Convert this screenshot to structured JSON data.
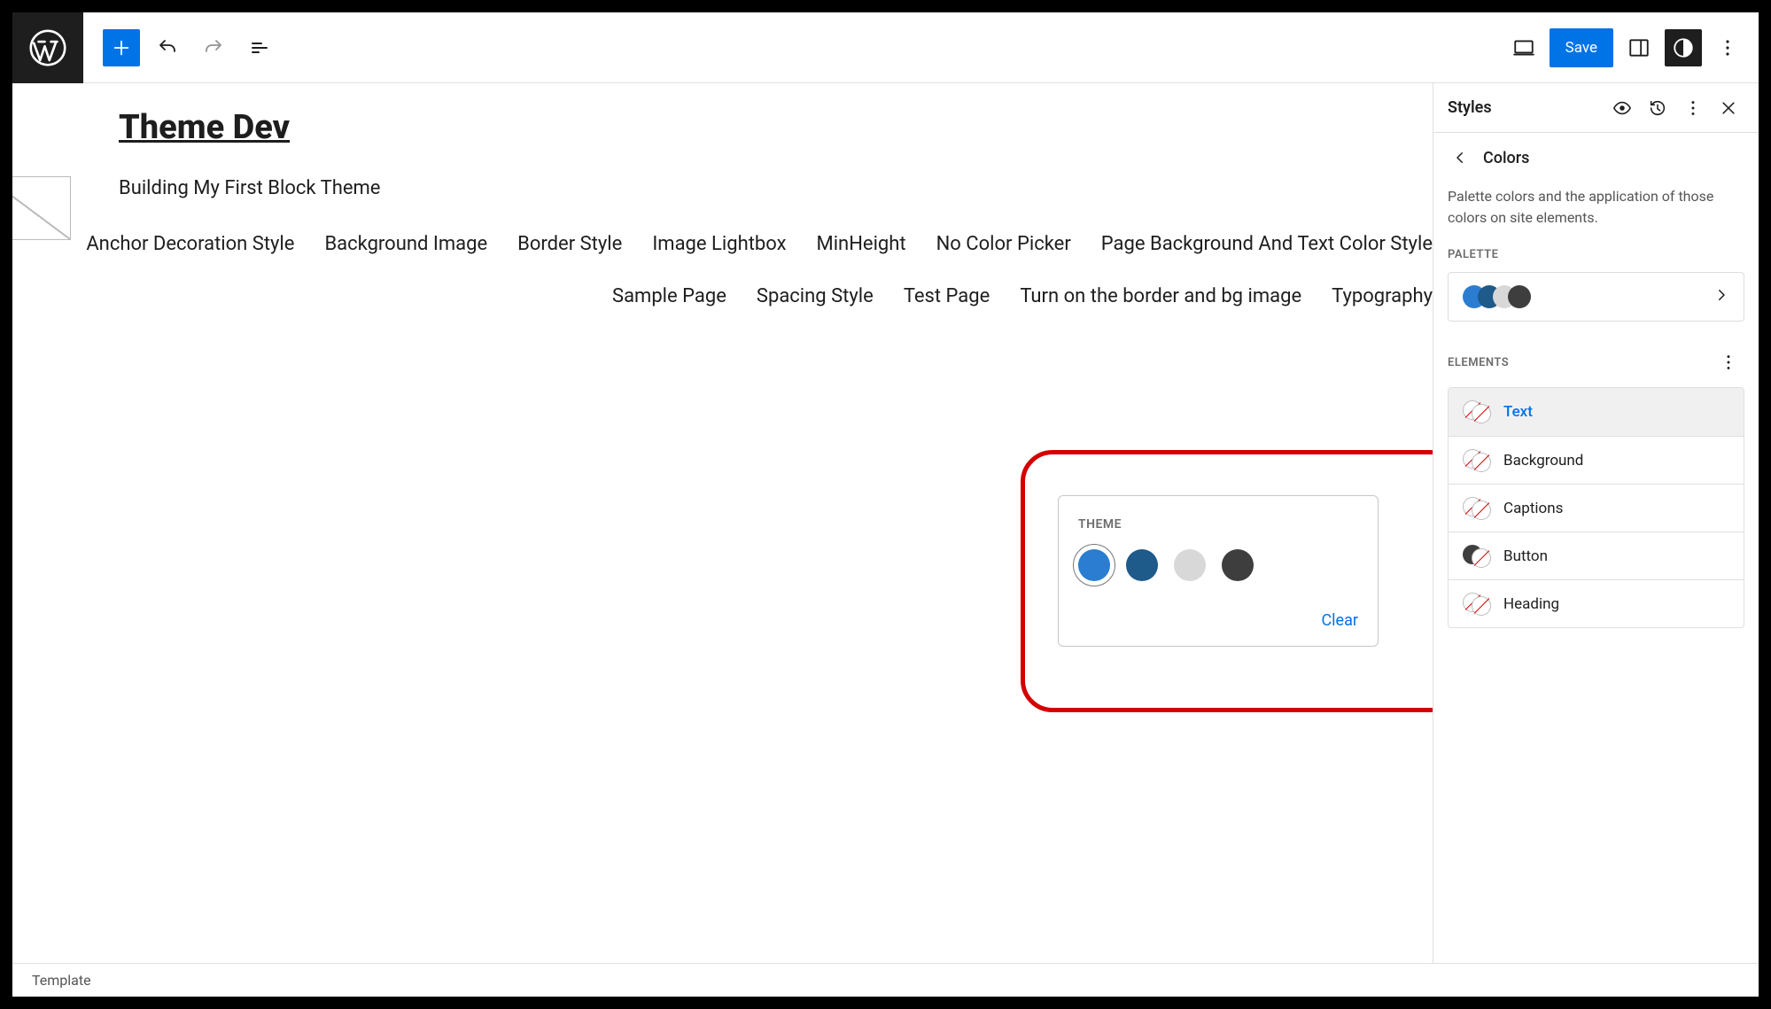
{
  "toolbar": {
    "save_label": "Save"
  },
  "site": {
    "title": "Theme Dev",
    "tagline": "Building My First Block Theme"
  },
  "nav": [
    "Anchor Decoration Style",
    "Background Image",
    "Border Style",
    "Image Lightbox",
    "MinHeight",
    "No Color Picker",
    "Page Background And Text Color Style",
    "Sample Page",
    "Spacing Style",
    "Test Page",
    "Turn on the border and bg image",
    "Typography"
  ],
  "popover": {
    "title": "THEME",
    "clear_label": "Clear",
    "swatches": [
      "#2a7dd1",
      "#1e5a8a",
      "#d8d8d8",
      "#3e3e3e"
    ]
  },
  "sidebar": {
    "title": "Styles",
    "section": "Colors",
    "description": "Palette colors and the application of those colors on site elements.",
    "palette_label": "PALETTE",
    "palette_colors": [
      "#2a7dd1",
      "#1e5a8a",
      "#d8d8d8",
      "#3e3e3e"
    ],
    "elements_label": "ELEMENTS",
    "elements": [
      {
        "label": "Text",
        "c1": null,
        "c2": null,
        "active": true
      },
      {
        "label": "Background",
        "c1": null,
        "c2": null,
        "active": false
      },
      {
        "label": "Captions",
        "c1": null,
        "c2": null,
        "active": false
      },
      {
        "label": "Button",
        "c1": "#3e3e3e",
        "c2": null,
        "active": false
      },
      {
        "label": "Heading",
        "c1": null,
        "c2": null,
        "active": false
      }
    ]
  },
  "footer": {
    "label": "Template"
  }
}
